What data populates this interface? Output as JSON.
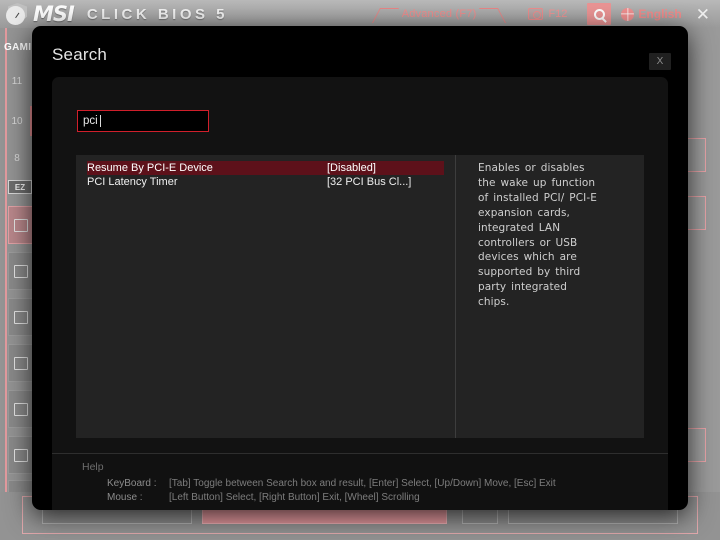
{
  "header": {
    "brand": "MSI",
    "product": "CLICK BIOS 5",
    "advanced_label": "Advanced (F7)",
    "screenshot_key": "F12",
    "language": "English",
    "close_label": "✕",
    "icons": {
      "camera": "camera-icon",
      "search": "search-icon",
      "globe": "globe-icon"
    }
  },
  "sidebar": {
    "gaming_label": "GAMI",
    "numbers": [
      "11",
      "10",
      "8"
    ],
    "ez_label": "EZ"
  },
  "dialog": {
    "title": "Search",
    "close_label": "X",
    "search": {
      "value": "pci",
      "placeholder": ""
    },
    "results": [
      {
        "name": "Resume By PCI-E Device",
        "value": "[Disabled]",
        "selected": true
      },
      {
        "name": "PCI Latency Timer",
        "value": "[32 PCI Bus Cl...]",
        "selected": false
      }
    ],
    "help_description": "Enables or disables the wake up function of installed PCI/ PCI-E expansion cards, integrated LAN controllers or USB devices which are supported by third party integrated chips.",
    "footer": {
      "help_label": "Help",
      "keyboard_label": "KeyBoard :",
      "keyboard_text": "[Tab] Toggle between Search box and result,   [Enter] Select,   [Up/Down] Move,   [Esc] Exit",
      "mouse_label": "Mouse     :",
      "mouse_text": "[Left Button] Select,   [Right Button] Exit,   [Wheel] Scrolling"
    }
  },
  "colors": {
    "accent_red": "#d01f2b",
    "selection_red": "#5d111a",
    "brand_pink": "#ef8f8f",
    "modal_bg": "#000000",
    "panel_bg": "#232323"
  }
}
